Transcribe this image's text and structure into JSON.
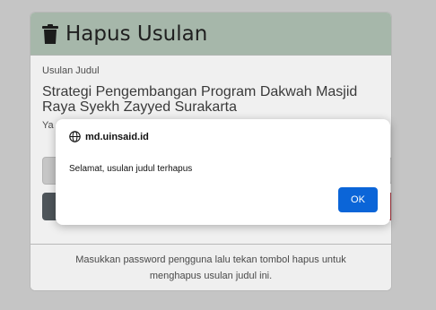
{
  "card": {
    "title": "Hapus Usulan",
    "title_icon": "trash-icon",
    "field_label": "Usulan Judul",
    "field_value": "Strategi Pengembangan Program Dakwah Masjid Raya Syekh Zayyed Surakarta",
    "second_label_visible": "Ya",
    "footer_text": "Masukkan password pengguna lalu tekan tombol hapus untuk menghapus usulan judul ini."
  },
  "dialog": {
    "origin": "md.uinsaid.id",
    "origin_icon": "globe-icon",
    "message": "Selamat, usulan judul terhapus",
    "ok_label": "OK"
  },
  "colors": {
    "header_bg": "#a6b7aa",
    "ok_button": "#0b65d8",
    "delete_button": "#a5333c",
    "back_button": "#4e555a"
  }
}
